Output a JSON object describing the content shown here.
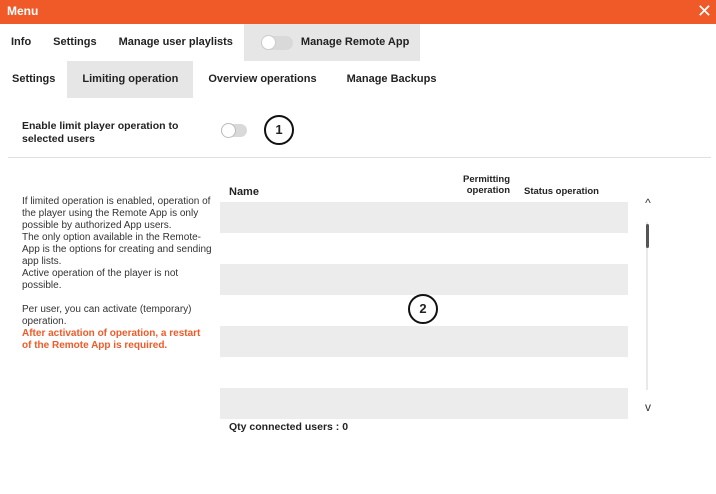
{
  "window": {
    "title": "Menu",
    "close_symbol": "✕"
  },
  "top_tabs": [
    "Info",
    "Settings",
    "Manage user playlists",
    "Manage Remote App"
  ],
  "sub_tabs": [
    "Settings",
    "Limiting operation",
    "Overview operations",
    "Manage Backups"
  ],
  "enable": {
    "label": "Enable limit player operation to selected users",
    "enabled": false
  },
  "markers": [
    "1",
    "2"
  ],
  "info": {
    "p1": "If limited operation is enabled, operation of the player using the Remote App is only possible by authorized App users.",
    "p2": "The only option available in the Remote-App is the options for creating and sending app lists.",
    "p3": "Active operation of the player is not possible.",
    "p4": "Per user, you can activate (temporary) operation.",
    "warning": "After activation of operation, a restart of the Remote App is required."
  },
  "table": {
    "col_name": "Name",
    "col_permit": "Permitting operation",
    "col_status": "Status operation",
    "rows": []
  },
  "footer": {
    "qty": "Qty connected users : 0"
  },
  "icons": {
    "scroll_up": "^",
    "scroll_down": "v"
  },
  "colors": {
    "accent": "#f05a28",
    "tab_active": "#e6e6e6",
    "row_stripe": "#ececec"
  }
}
